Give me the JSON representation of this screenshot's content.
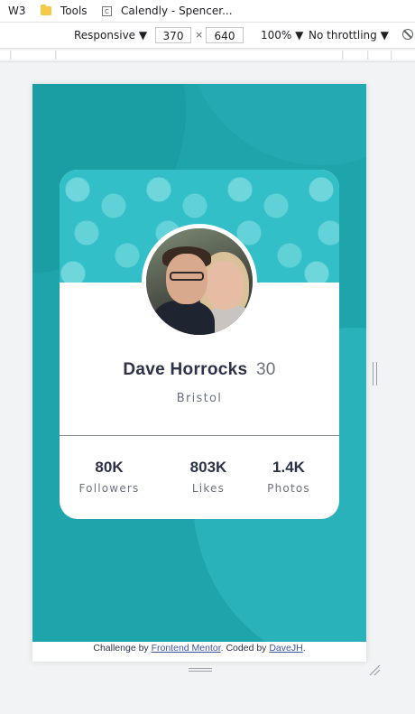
{
  "bookmarks": [
    {
      "label": "W3",
      "icon": "bookmark-icon"
    },
    {
      "label": "Tools",
      "icon": "folder-icon"
    },
    {
      "label": "Calendly - Spencer...",
      "icon": "calendly-favicon"
    }
  ],
  "device_toolbar": {
    "mode": "Responsive",
    "width": "370",
    "separator": "×",
    "height": "640",
    "zoom": "100%",
    "throttling": "No throttling"
  },
  "profile": {
    "name": "Dave Horrocks",
    "age": "30",
    "city": "Bristol"
  },
  "stats": [
    {
      "value": "80K",
      "label": "Followers"
    },
    {
      "value": "803K",
      "label": "Likes"
    },
    {
      "value": "1.4K",
      "label": "Photos"
    }
  ],
  "footer": {
    "prefix": "Challenge by ",
    "link1": "Frontend Mentor",
    "middle": ". Coded by ",
    "link2": "DaveJH",
    "suffix": "."
  },
  "colors": {
    "background": "#1ea5ac",
    "card_header": "#33bfc7",
    "text_dark": "#2d3248",
    "text_muted": "#6b7082",
    "link": "#3e52a3"
  }
}
